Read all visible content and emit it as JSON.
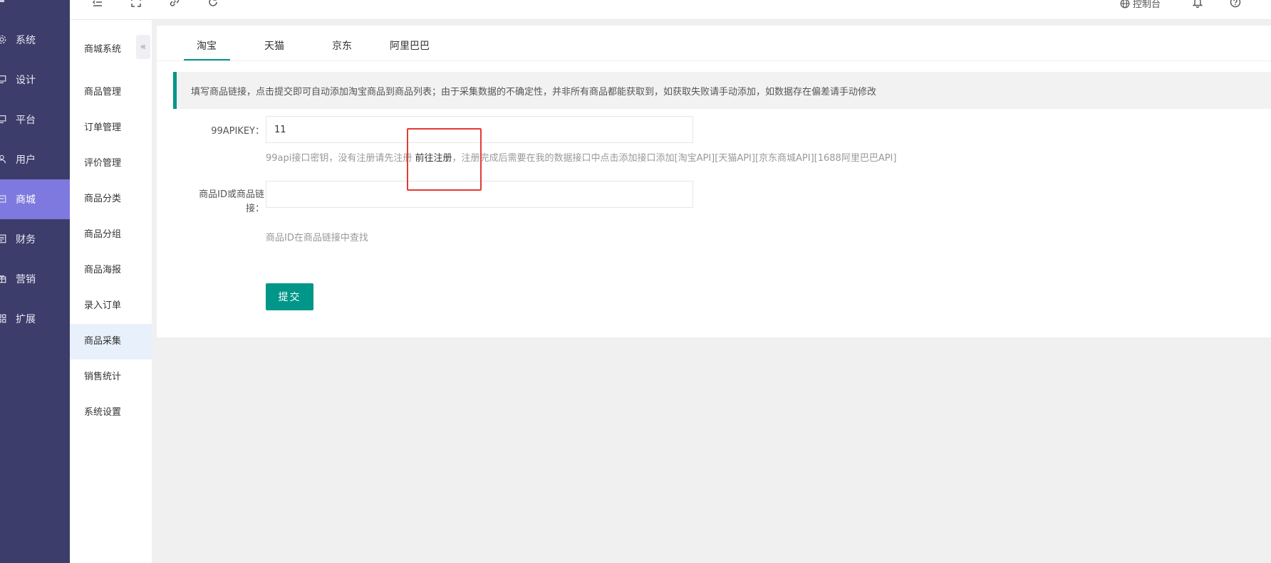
{
  "nav": {
    "items": [
      {
        "label": "系统",
        "icon": "gear-icon"
      },
      {
        "label": "设计",
        "icon": "monitor-icon"
      },
      {
        "label": "平台",
        "icon": "monitor-icon"
      },
      {
        "label": "用户",
        "icon": "user-icon"
      },
      {
        "label": "商城",
        "icon": "shop-icon",
        "active": true
      },
      {
        "label": "财务",
        "icon": "ledger-icon"
      },
      {
        "label": "营销",
        "icon": "gift-icon"
      },
      {
        "label": "扩展",
        "icon": "grid-icon"
      }
    ]
  },
  "topbar": {
    "icons": [
      "menu-fold-icon",
      "fullscreen-icon",
      "link-icon",
      "refresh-icon",
      "bell-icon",
      "help-icon"
    ],
    "console_label": "控制台"
  },
  "subnav": {
    "title": "商城系统",
    "collapse_glyph": "«",
    "items": [
      {
        "label": "商品管理"
      },
      {
        "label": "订单管理"
      },
      {
        "label": "评价管理"
      },
      {
        "label": "商品分类"
      },
      {
        "label": "商品分组"
      },
      {
        "label": "商品海报"
      },
      {
        "label": "录入订单"
      },
      {
        "label": "商品采集",
        "active": true
      },
      {
        "label": "销售统计"
      },
      {
        "label": "系统设置"
      }
    ]
  },
  "tabs": [
    {
      "label": "淘宝",
      "active": true
    },
    {
      "label": "天猫"
    },
    {
      "label": "京东"
    },
    {
      "label": "阿里巴巴"
    }
  ],
  "notice": "填写商品链接，点击提交即可自动添加淘宝商品到商品列表；由于采集数据的不确定性，并非所有商品都能获取到，如获取失败请手动添加，如数据存在偏差请手动修改",
  "form": {
    "apikey_label": "99APIKEY：",
    "apikey_value": "11",
    "apikey_help_before": "99api接口密钥，没有注册请先注册 ",
    "apikey_help_link": "前往注册",
    "apikey_help_after": "，注册完成后需要在我的数据接口中点击添加接口添加[淘宝API][天猫API][京东商城API][1688阿里巴巴API]",
    "product_label_line1": "商品ID或商品链",
    "product_label_line2": "接：",
    "product_value": "",
    "product_help": "商品ID在商品链接中查找",
    "submit_label": "提交"
  },
  "colors": {
    "nav_bg": "#3d3d6b",
    "nav_active": "#7d79de",
    "accent": "#009688",
    "highlight_box": "#e53935"
  }
}
